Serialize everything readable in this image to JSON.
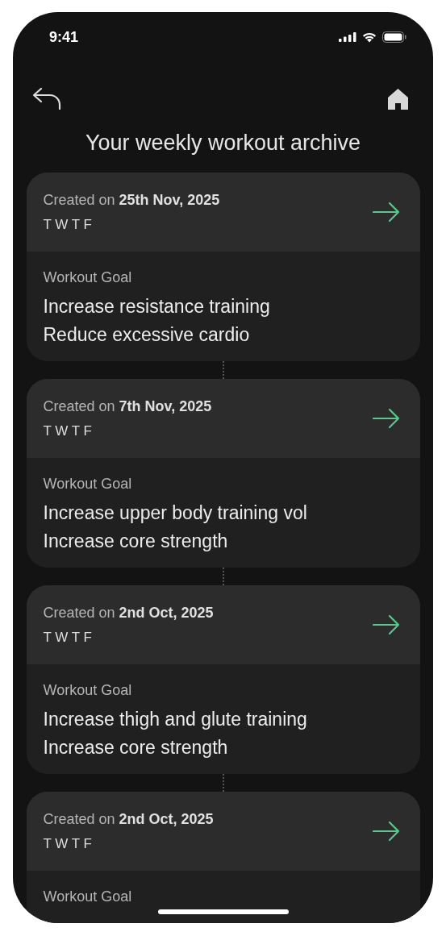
{
  "status_bar": {
    "time": "9:41"
  },
  "title": "Your weekly workout archive",
  "entries": [
    {
      "created": "Created on **25th Nov, 2025**",
      "days": "T W T F",
      "goal_label": "Workout Goal",
      "goals": [
        "Increase resistance training",
        "Reduce excessive cardio"
      ]
    },
    {
      "created": "Created on **7th Nov, 2025**",
      "days": "T W T F",
      "goal_label": "Workout Goal",
      "goals": [
        "Increase upper body training vol",
        "Increase core strength"
      ]
    },
    {
      "created": "Created on **2nd Oct, 2025**",
      "days": "T W T F",
      "goal_label": "Workout Goal",
      "goals": [
        "Increase thigh and glute training",
        "Increase core strength"
      ]
    },
    {
      "created": "Created on **2nd Oct, 2025**",
      "days": "T W T F",
      "goal_label": "Workout Goal"
    }
  ]
}
